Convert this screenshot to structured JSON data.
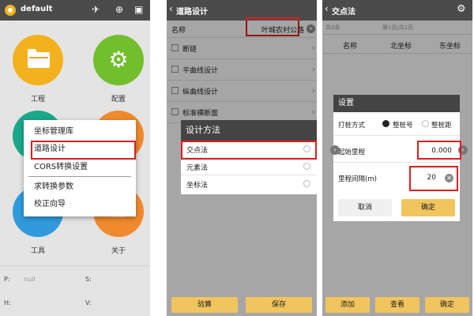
{
  "screen1": {
    "app_title": "default",
    "tiles": [
      {
        "label": "工程",
        "color": "#f3b21d",
        "icon": "folder-icon"
      },
      {
        "label": "配置",
        "color": "#72bf2e",
        "icon": "gear-icon"
      },
      {
        "label": "工具",
        "color": "#2f9bdc",
        "icon": "tools-icon"
      },
      {
        "label": "关于",
        "color": "#ef8b2d",
        "icon": "info-icon"
      }
    ],
    "menu": {
      "items": [
        "坐标管理库",
        "道路设计",
        "CORS转换设置",
        "求转换参数",
        "校正向导"
      ],
      "selected_index": 1
    },
    "status": {
      "p_label": "P:",
      "p_value": "null",
      "s_label": "S:",
      "h_label": "H:",
      "v_label": "V:"
    }
  },
  "screen2": {
    "title": "道路设计",
    "name_label": "名称",
    "name_value": "叶城农村公路",
    "rows": [
      "断链",
      "平曲线设计",
      "纵曲线设计",
      "标准横断面"
    ],
    "dialog": {
      "title": "设计方法",
      "options": [
        "交点法",
        "元素法",
        "坐标法"
      ],
      "selected_index": 0
    },
    "buttons": {
      "calc": "验算",
      "save": "保存"
    }
  },
  "screen3": {
    "title": "交点法",
    "count_text": "共0条",
    "page_text": "第1页/共1页",
    "columns": [
      "名称",
      "北坐标",
      "东坐标"
    ],
    "dialog": {
      "title": "设置",
      "stake_mode_label": "打桩方式",
      "mode_options": [
        "整桩号",
        "整桩距"
      ],
      "mode_selected_index": 0,
      "start_label": "起始里程",
      "start_value": "0.000",
      "interval_label": "里程间隔(m)",
      "interval_value": "20",
      "cancel": "取消",
      "confirm": "确定"
    },
    "buttons": {
      "add": "添加",
      "view": "查看",
      "ok": "确定"
    }
  },
  "colors": {
    "highlight": "#e01d1d",
    "accent": "#f1c55e",
    "topbar": "#4b4b4b",
    "radio_selected": "#222222"
  }
}
